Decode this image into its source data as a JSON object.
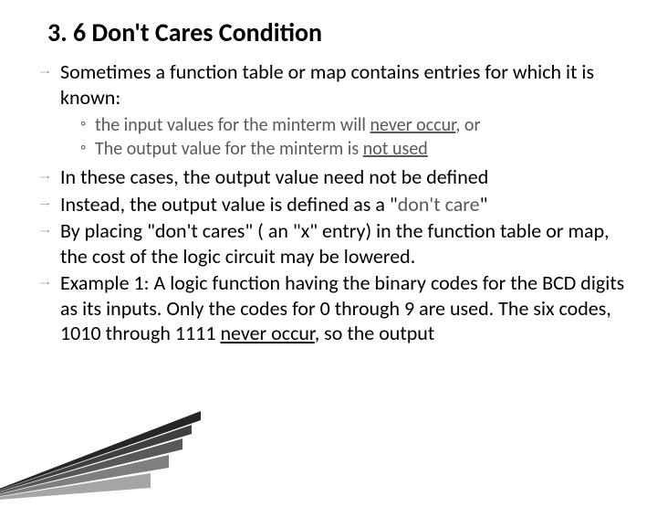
{
  "title": "3. 6 Don't Cares Condition",
  "bullets": {
    "b1": "Sometimes a function table or map contains entries for which it is known:",
    "b1_sub1_a": "the input values for the minterm will ",
    "b1_sub1_u": "never occur",
    "b1_sub1_b": ", or",
    "b1_sub2_a": "The output value for the minterm is ",
    "b1_sub2_u": "not used",
    "b2": "In these cases, the output value need not be defined",
    "b3_a": "Instead, the output value is defined as a \"",
    "b3_g": "don't care",
    "b3_b": "\"",
    "b4": "By placing \"don't cares\" ( an \"x\" entry) in the function table or map, the cost of the logic circuit may be lowered.",
    "b5_a": "Example   1:  A logic function having the binary codes for the BCD digits as its inputs. Only the codes for 0 through 9 are used.  The six codes, 1010 through 1111 ",
    "b5_u": "never occur",
    "b5_b": ", so the output"
  }
}
